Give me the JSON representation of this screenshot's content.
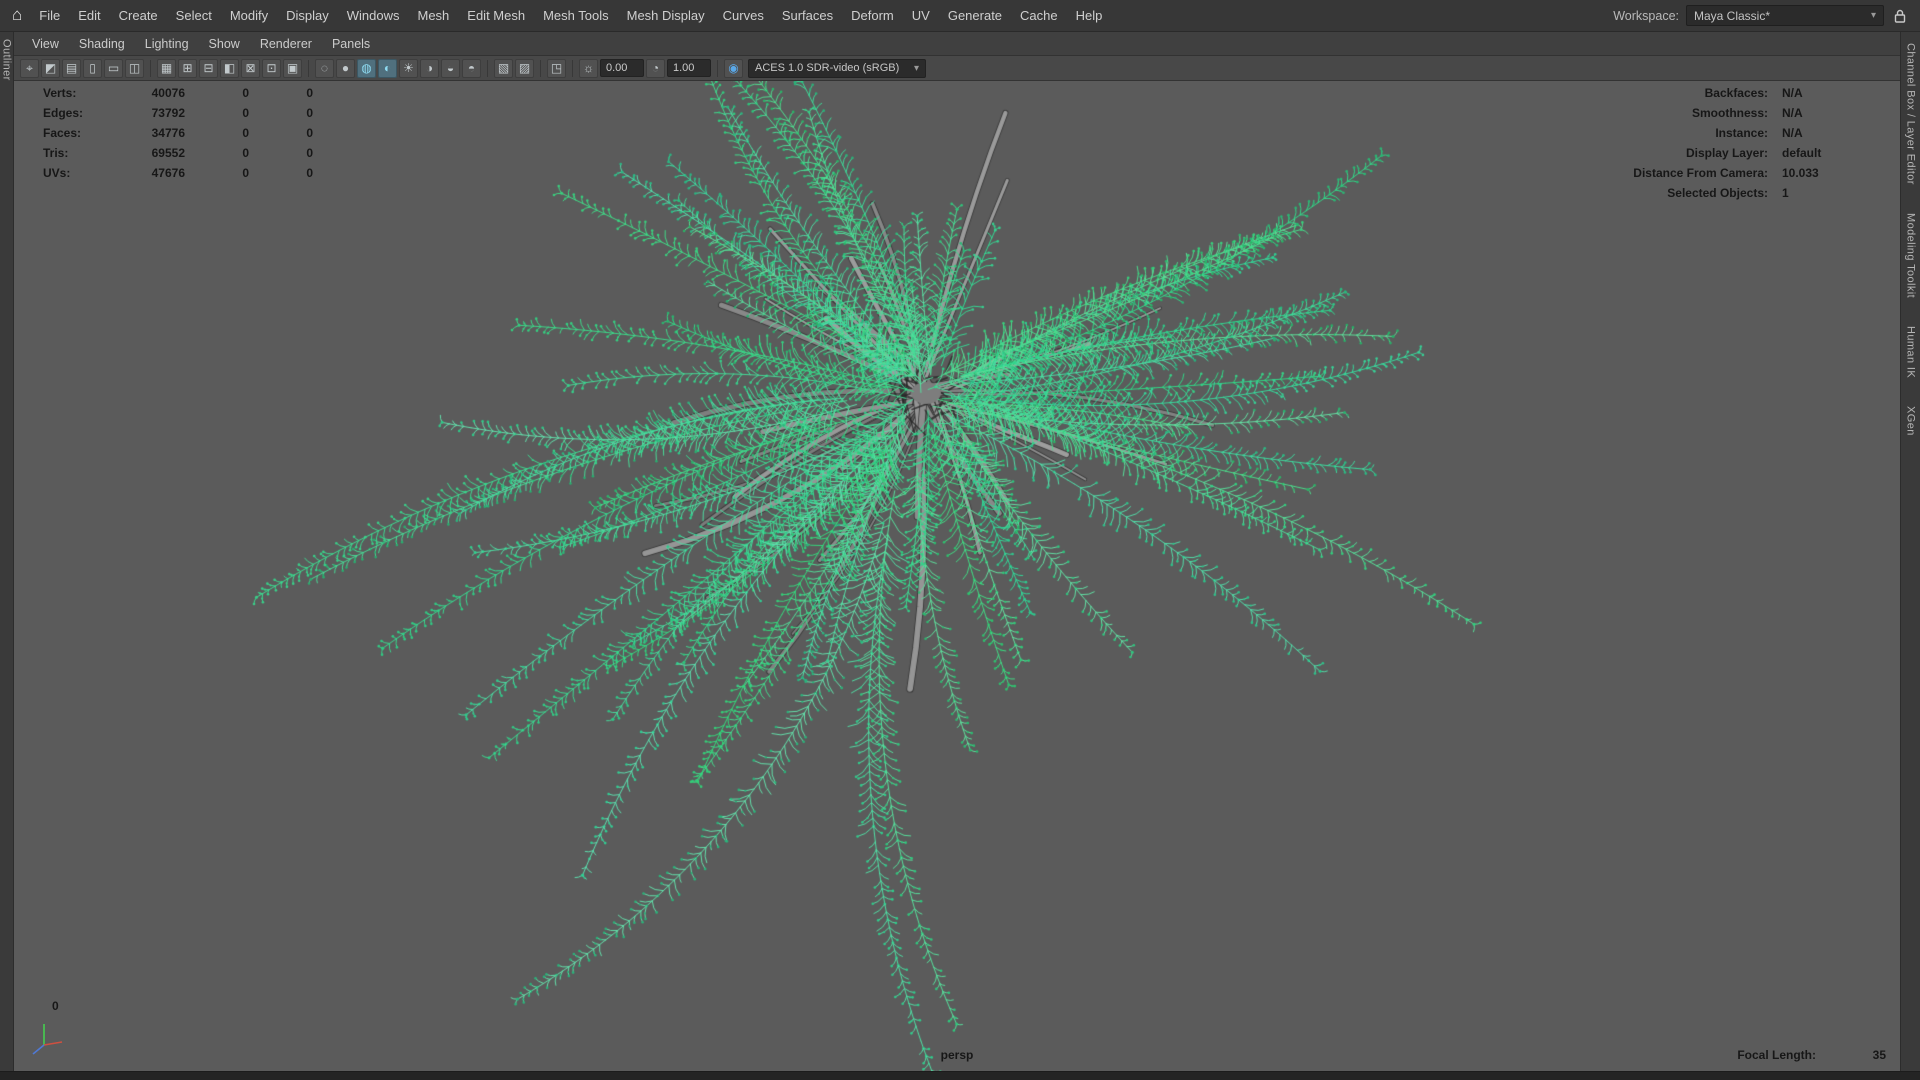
{
  "menubar": {
    "home_icon": "⌂",
    "items": [
      "File",
      "Edit",
      "Create",
      "Select",
      "Modify",
      "Display",
      "Windows",
      "Mesh",
      "Edit Mesh",
      "Mesh Tools",
      "Mesh Display",
      "Curves",
      "Surfaces",
      "Deform",
      "UV",
      "Generate",
      "Cache",
      "Help"
    ],
    "workspace_label": "Workspace:",
    "workspace_value": "Maya Classic*",
    "dropdown_caret": "▾"
  },
  "panel_menubar": {
    "items": [
      "View",
      "Shading",
      "Lighting",
      "Show",
      "Renderer",
      "Panels"
    ]
  },
  "toolbar": {
    "exposure_value": "0.00",
    "gamma_value": "1.00",
    "colorspace_value": "ACES 1.0 SDR-video (sRGB)",
    "colorspace_caret": "▾",
    "icons": [
      {
        "name": "camera-select",
        "glyph": "⌖"
      },
      {
        "name": "camera-lock",
        "glyph": "◩"
      },
      {
        "name": "camera-attributes",
        "glyph": "▤"
      },
      {
        "name": "bookmarks",
        "glyph": "▯"
      },
      {
        "name": "image-plane",
        "glyph": "▭"
      },
      {
        "name": "pan-zoom",
        "glyph": "◫"
      },
      {
        "type": "sep"
      },
      {
        "name": "grid",
        "glyph": "▦"
      },
      {
        "name": "film-gate",
        "glyph": "⊞"
      },
      {
        "name": "resolution-gate",
        "glyph": "⊟"
      },
      {
        "name": "gate-mask",
        "glyph": "◧"
      },
      {
        "name": "field-chart",
        "glyph": "⊠"
      },
      {
        "name": "safe-action",
        "glyph": "⊡"
      },
      {
        "name": "safe-title",
        "glyph": "▣"
      },
      {
        "type": "sep"
      },
      {
        "name": "wireframe",
        "glyph": "◌"
      },
      {
        "name": "smooth-shade-all",
        "glyph": "●"
      },
      {
        "name": "wireframe-on-shaded",
        "glyph": "◍",
        "active": true
      },
      {
        "name": "textured",
        "glyph": "◐",
        "active": true
      },
      {
        "name": "use-all-lights",
        "glyph": "☀"
      },
      {
        "name": "shadows",
        "glyph": "◑"
      },
      {
        "name": "screen-space-ao",
        "glyph": "◒"
      },
      {
        "name": "motion-blur",
        "glyph": "◓"
      },
      {
        "type": "sep"
      },
      {
        "name": "multisample-aa",
        "glyph": "▧"
      },
      {
        "name": "transparency",
        "glyph": "▨"
      },
      {
        "type": "sep"
      },
      {
        "name": "isolate-select",
        "glyph": "◳"
      },
      {
        "type": "sep"
      },
      {
        "name": "exposure",
        "glyph": "☼"
      },
      {
        "type": "field",
        "name": "exposure-field",
        "key": "exposure_value"
      },
      {
        "name": "gamma",
        "glyph": "◔"
      },
      {
        "type": "field",
        "name": "gamma-field",
        "key": "gamma_value"
      },
      {
        "type": "sep"
      },
      {
        "name": "color-managed",
        "glyph": "◉",
        "color": "#5aa8e8"
      }
    ]
  },
  "side_tabs": {
    "left": [
      "Outliner"
    ],
    "right": [
      "Channel Box / Layer Editor",
      "Modeling Toolkit",
      "Human IK",
      "XGen"
    ]
  },
  "hud": {
    "left": [
      {
        "label": "Verts:",
        "v1": "40076",
        "v2": "0",
        "v3": "0"
      },
      {
        "label": "Edges:",
        "v1": "73792",
        "v2": "0",
        "v3": "0"
      },
      {
        "label": "Faces:",
        "v1": "34776",
        "v2": "0",
        "v3": "0"
      },
      {
        "label": "Tris:",
        "v1": "69552",
        "v2": "0",
        "v3": "0"
      },
      {
        "label": "UVs:",
        "v1": "47676",
        "v2": "0",
        "v3": "0"
      }
    ],
    "right": [
      {
        "label": "Backfaces:",
        "value": "N/A"
      },
      {
        "label": "Smoothness:",
        "value": "N/A"
      },
      {
        "label": "Instance:",
        "value": "N/A"
      },
      {
        "label": "Display Layer:",
        "value": "default"
      },
      {
        "label": "Distance From Camera:",
        "value": "10.033"
      },
      {
        "label": "Selected Objects:",
        "value": "1"
      }
    ],
    "camera": "persp",
    "focal_length_label": "Focal Length:",
    "focal_length_value": "35",
    "origin_label": "0"
  },
  "colors": {
    "selection_green": "#3fe08f",
    "viewport_bg": "#5b5b5b",
    "gray_branch": "#8b8b8b"
  }
}
